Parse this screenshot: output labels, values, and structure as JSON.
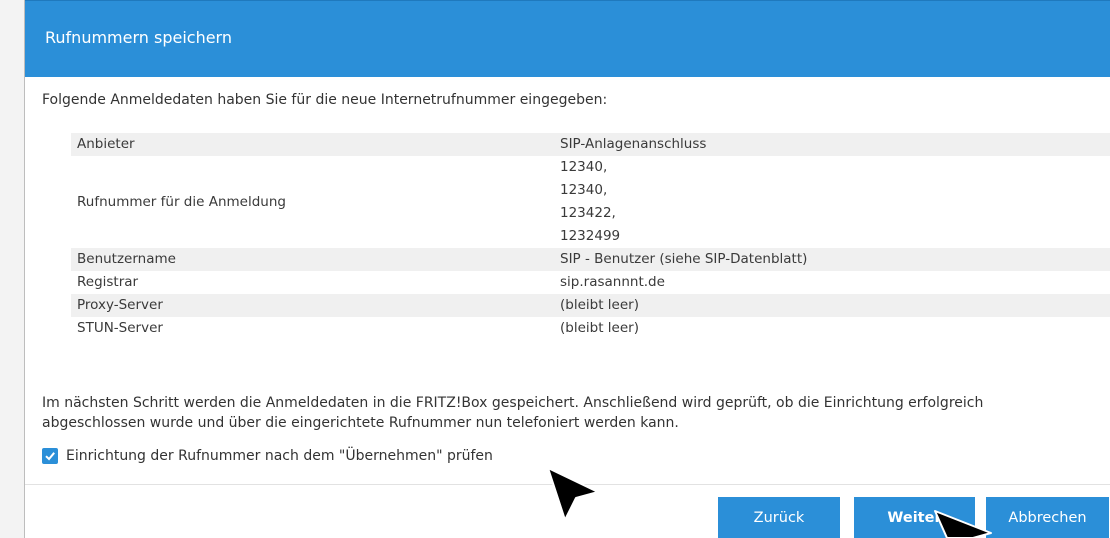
{
  "dialog": {
    "title": "Rufnummern speichern",
    "intro": "Folgende Anmeldedaten haben Sie für die neue Internetrufnummer eingegeben:",
    "rows": [
      {
        "label": "Anbieter",
        "value": [
          "SIP-Anlagenanschluss"
        ]
      },
      {
        "label": "Rufnummer für die Anmeldung",
        "value": [
          "12340,",
          "12340,",
          "123422,",
          "1232499"
        ]
      },
      {
        "label": "Benutzername",
        "value": [
          "SIP - Benutzer (siehe SIP-Datenblatt)"
        ]
      },
      {
        "label": "Registrar",
        "value": [
          "sip.rasannnt.de"
        ]
      },
      {
        "label": "Proxy-Server",
        "value": [
          "(bleibt leer)"
        ]
      },
      {
        "label": "STUN-Server",
        "value": [
          "(bleibt leer)"
        ]
      }
    ],
    "info_line1": "Im nächsten Schritt werden die Anmeldedaten in die FRITZ!Box gespeichert. Anschließend wird geprüft, ob die Einrichtung erfolgreich",
    "info_line2": "abgeschlossen wurde und über die eingerichtete Rufnummer nun telefoniert werden kann.",
    "check_label": "Einrichtung der Rufnummer nach dem \"Übernehmen\" prüfen",
    "check_checked": true
  },
  "buttons": {
    "back": "Zurück",
    "next": "Weiter",
    "cancel": "Abbrechen"
  },
  "colors": {
    "accent": "#2b8fd8",
    "row_shade": "#f0f0f0"
  }
}
